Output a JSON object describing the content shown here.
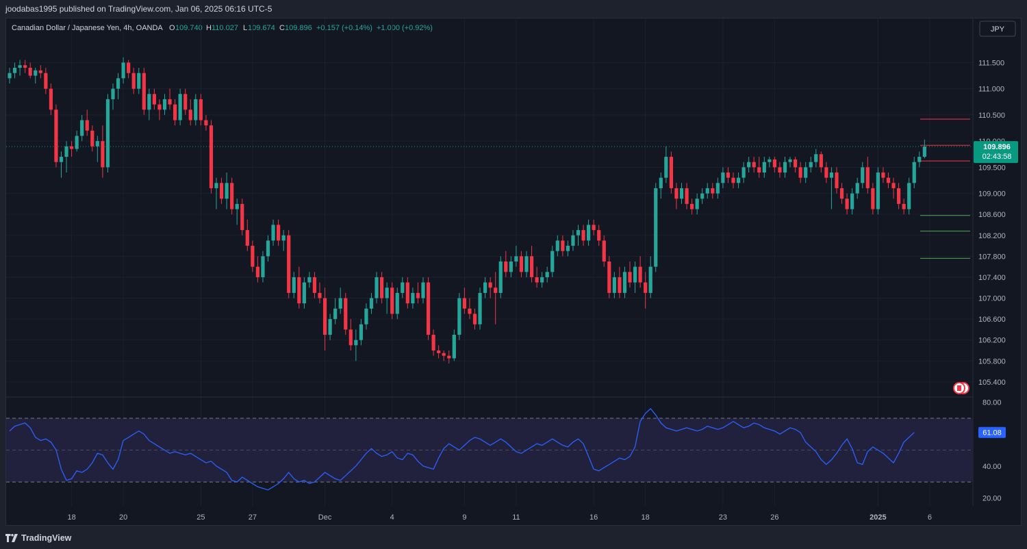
{
  "header": {
    "publisher_line": "joodabas1995 published on TradingView.com, Jan 06, 2025 06:16 UTC-5"
  },
  "symbol": {
    "title": "Canadian Dollar / Japanese Yen, 4h, OANDA",
    "open_label": "O",
    "open": "109.740",
    "high_label": "H",
    "high": "110.027",
    "low_label": "L",
    "low": "109.674",
    "close_label": "C",
    "close": "109.896",
    "change": "+0.157 (+0.14%)",
    "extra_change": "+1.000 (+0.92%)",
    "currency_button": "JPY"
  },
  "price_tag": {
    "price": "109.896",
    "countdown": "02:43:58"
  },
  "rsi_tag": "61.08",
  "colors": {
    "up": "#26a69a",
    "down": "#f23645",
    "rsi_line": "#2962ff",
    "band_fill": "#21213d",
    "last_price_line": "#089981",
    "h_resistance": "#f23645",
    "h_support": "#4caf50"
  },
  "chart_data": {
    "type": "candlestick",
    "timeframe": "4h",
    "price_axis": {
      "ylim": [
        105.15,
        111.95
      ],
      "ticks": [
        "111.500",
        "111.000",
        "110.500",
        "110.000",
        "109.500",
        "109.000",
        "108.600",
        "108.200",
        "107.800",
        "107.400",
        "107.000",
        "106.600",
        "106.200",
        "105.800",
        "105.400"
      ],
      "tick_values": [
        111.5,
        111.0,
        110.5,
        110.0,
        109.5,
        109.0,
        108.6,
        108.2,
        107.8,
        107.4,
        107.0,
        106.6,
        106.2,
        105.8,
        105.4
      ]
    },
    "x_axis": {
      "labels": [
        "18",
        "20",
        "25",
        "27",
        "Dec",
        "4",
        "9",
        "11",
        "16",
        "18",
        "23",
        "26",
        "2025",
        "6"
      ],
      "label_index": [
        12,
        22,
        37,
        47,
        61,
        74,
        88,
        98,
        113,
        123,
        138,
        148,
        168,
        178
      ]
    },
    "candles_ohlc": [
      [
        111.2,
        111.4,
        111.1,
        111.3
      ],
      [
        111.3,
        111.5,
        111.2,
        111.4
      ],
      [
        111.4,
        111.55,
        111.25,
        111.45
      ],
      [
        111.45,
        111.55,
        111.3,
        111.4
      ],
      [
        111.4,
        111.5,
        111.2,
        111.25
      ],
      [
        111.25,
        111.4,
        111.1,
        111.35
      ],
      [
        111.35,
        111.45,
        111.2,
        111.3
      ],
      [
        111.3,
        111.4,
        110.9,
        111.0
      ],
      [
        111.0,
        111.1,
        110.5,
        110.6
      ],
      [
        110.6,
        110.7,
        109.5,
        109.6
      ],
      [
        109.6,
        109.8,
        109.3,
        109.7
      ],
      [
        109.7,
        110.0,
        109.4,
        109.9
      ],
      [
        109.9,
        110.0,
        109.7,
        109.85
      ],
      [
        109.85,
        110.2,
        109.8,
        110.1
      ],
      [
        110.1,
        110.5,
        110.0,
        110.4
      ],
      [
        110.4,
        110.6,
        110.1,
        110.2
      ],
      [
        110.2,
        110.3,
        109.8,
        109.9
      ],
      [
        109.9,
        110.1,
        109.6,
        110.0
      ],
      [
        110.0,
        110.3,
        109.3,
        109.5
      ],
      [
        109.5,
        110.9,
        109.4,
        110.8
      ],
      [
        110.8,
        111.1,
        110.6,
        111.0
      ],
      [
        111.0,
        111.3,
        110.8,
        111.2
      ],
      [
        111.2,
        111.6,
        111.1,
        111.5
      ],
      [
        111.5,
        111.55,
        111.2,
        111.3
      ],
      [
        111.3,
        111.4,
        110.9,
        111.0
      ],
      [
        111.0,
        111.4,
        110.9,
        111.3
      ],
      [
        111.3,
        111.4,
        110.5,
        110.6
      ],
      [
        110.6,
        111.0,
        110.4,
        110.9
      ],
      [
        110.9,
        111.0,
        110.6,
        110.7
      ],
      [
        110.7,
        110.8,
        110.4,
        110.6
      ],
      [
        110.6,
        110.9,
        110.5,
        110.8
      ],
      [
        110.8,
        111.0,
        110.6,
        110.7
      ],
      [
        110.7,
        110.8,
        110.3,
        110.4
      ],
      [
        110.4,
        111.0,
        110.3,
        110.9
      ],
      [
        110.9,
        111.0,
        110.5,
        110.6
      ],
      [
        110.6,
        110.8,
        110.3,
        110.4
      ],
      [
        110.4,
        110.9,
        110.3,
        110.8
      ],
      [
        110.8,
        110.9,
        110.3,
        110.4
      ],
      [
        110.4,
        110.5,
        110.2,
        110.3
      ],
      [
        110.3,
        110.4,
        109.0,
        109.1
      ],
      [
        109.1,
        109.3,
        108.7,
        109.2
      ],
      [
        109.2,
        109.3,
        108.8,
        108.9
      ],
      [
        108.9,
        109.4,
        108.7,
        109.2
      ],
      [
        109.2,
        109.3,
        108.6,
        108.7
      ],
      [
        108.7,
        108.9,
        108.4,
        108.8
      ],
      [
        108.8,
        108.9,
        108.2,
        108.3
      ],
      [
        108.3,
        108.5,
        107.9,
        108.0
      ],
      [
        108.0,
        108.1,
        107.5,
        107.6
      ],
      [
        107.6,
        107.8,
        107.3,
        107.4
      ],
      [
        107.4,
        107.9,
        107.3,
        107.8
      ],
      [
        107.8,
        108.2,
        107.7,
        108.1
      ],
      [
        108.1,
        108.5,
        108.0,
        108.4
      ],
      [
        108.4,
        108.5,
        108.0,
        108.1
      ],
      [
        108.1,
        108.3,
        107.9,
        108.2
      ],
      [
        108.2,
        108.3,
        107.0,
        107.1
      ],
      [
        107.1,
        107.5,
        107.0,
        107.4
      ],
      [
        107.4,
        107.6,
        106.8,
        106.9
      ],
      [
        106.9,
        107.4,
        106.8,
        107.3
      ],
      [
        107.3,
        107.5,
        107.2,
        107.4
      ],
      [
        107.4,
        107.5,
        107.0,
        107.1
      ],
      [
        107.1,
        107.3,
        106.9,
        107.0
      ],
      [
        107.0,
        107.2,
        106.0,
        106.3
      ],
      [
        106.3,
        106.7,
        106.2,
        106.6
      ],
      [
        106.6,
        107.0,
        106.5,
        106.8
      ],
      [
        106.8,
        107.2,
        106.7,
        107.0
      ],
      [
        107.0,
        107.1,
        106.3,
        106.4
      ],
      [
        106.4,
        106.6,
        106.0,
        106.1
      ],
      [
        106.1,
        106.4,
        105.8,
        106.2
      ],
      [
        106.2,
        106.6,
        106.1,
        106.5
      ],
      [
        106.5,
        106.9,
        106.4,
        106.8
      ],
      [
        106.8,
        107.1,
        106.7,
        107.0
      ],
      [
        107.0,
        107.5,
        106.9,
        107.4
      ],
      [
        107.4,
        107.5,
        106.9,
        107.0
      ],
      [
        107.0,
        107.3,
        106.7,
        107.2
      ],
      [
        107.2,
        107.3,
        106.6,
        106.7
      ],
      [
        106.7,
        107.2,
        106.6,
        107.1
      ],
      [
        107.1,
        107.4,
        107.0,
        107.3
      ],
      [
        107.3,
        107.4,
        106.8,
        106.9
      ],
      [
        106.9,
        107.2,
        106.8,
        107.1
      ],
      [
        107.1,
        107.3,
        106.9,
        107.0
      ],
      [
        107.0,
        107.4,
        106.9,
        107.3
      ],
      [
        107.3,
        107.4,
        106.2,
        106.3
      ],
      [
        106.3,
        106.4,
        105.9,
        106.0
      ],
      [
        106.0,
        106.1,
        105.85,
        105.95
      ],
      [
        105.95,
        106.0,
        105.8,
        105.9
      ],
      [
        105.9,
        106.0,
        105.75,
        105.85
      ],
      [
        105.85,
        106.4,
        105.8,
        106.3
      ],
      [
        106.3,
        107.1,
        106.2,
        107.0
      ],
      [
        107.0,
        107.2,
        106.7,
        106.8
      ],
      [
        106.8,
        107.0,
        106.6,
        106.7
      ],
      [
        106.7,
        106.8,
        106.4,
        106.5
      ],
      [
        106.5,
        107.2,
        106.4,
        107.1
      ],
      [
        107.1,
        107.4,
        107.0,
        107.3
      ],
      [
        107.3,
        107.4,
        107.0,
        107.2
      ],
      [
        107.2,
        107.5,
        106.5,
        107.1
      ],
      [
        107.1,
        107.8,
        107.0,
        107.7
      ],
      [
        107.7,
        107.9,
        107.4,
        107.5
      ],
      [
        107.5,
        107.8,
        107.4,
        107.7
      ],
      [
        107.7,
        108.0,
        107.6,
        107.8
      ],
      [
        107.8,
        107.9,
        107.4,
        107.5
      ],
      [
        107.5,
        107.9,
        107.4,
        107.8
      ],
      [
        107.8,
        108.0,
        107.3,
        107.4
      ],
      [
        107.4,
        107.6,
        107.2,
        107.3
      ],
      [
        107.3,
        107.5,
        107.2,
        107.4
      ],
      [
        107.4,
        107.6,
        107.3,
        107.5
      ],
      [
        107.5,
        108.0,
        107.4,
        107.9
      ],
      [
        107.9,
        108.2,
        107.8,
        108.1
      ],
      [
        108.1,
        108.2,
        107.8,
        107.9
      ],
      [
        107.9,
        108.1,
        107.8,
        108.0
      ],
      [
        108.0,
        108.3,
        107.9,
        108.2
      ],
      [
        108.2,
        108.4,
        108.0,
        108.3
      ],
      [
        108.3,
        108.4,
        108.0,
        108.1
      ],
      [
        108.1,
        108.5,
        108.0,
        108.4
      ],
      [
        108.4,
        108.5,
        108.2,
        108.3
      ],
      [
        108.3,
        108.4,
        108.0,
        108.1
      ],
      [
        108.1,
        108.2,
        107.6,
        107.7
      ],
      [
        107.7,
        107.8,
        107.0,
        107.1
      ],
      [
        107.1,
        107.5,
        107.0,
        107.4
      ],
      [
        107.4,
        107.6,
        107.0,
        107.1
      ],
      [
        107.1,
        107.6,
        107.0,
        107.5
      ],
      [
        107.5,
        107.7,
        107.2,
        107.3
      ],
      [
        107.3,
        107.7,
        107.1,
        107.6
      ],
      [
        107.6,
        107.8,
        107.2,
        107.3
      ],
      [
        107.3,
        107.5,
        106.8,
        107.1
      ],
      [
        107.1,
        107.8,
        107.0,
        107.6
      ],
      [
        107.6,
        109.2,
        107.5,
        109.1
      ],
      [
        109.1,
        109.4,
        108.9,
        109.3
      ],
      [
        109.3,
        109.9,
        109.2,
        109.7
      ],
      [
        109.7,
        109.8,
        109.0,
        109.1
      ],
      [
        109.1,
        109.2,
        108.7,
        108.9
      ],
      [
        108.9,
        109.2,
        108.8,
        109.1
      ],
      [
        109.1,
        109.2,
        108.7,
        108.8
      ],
      [
        108.8,
        108.9,
        108.6,
        108.7
      ],
      [
        108.7,
        109.0,
        108.6,
        108.9
      ],
      [
        108.9,
        109.1,
        108.8,
        109.0
      ],
      [
        109.0,
        109.2,
        108.9,
        109.1
      ],
      [
        109.1,
        109.2,
        108.9,
        109.0
      ],
      [
        109.0,
        109.3,
        108.9,
        109.2
      ],
      [
        109.2,
        109.5,
        109.1,
        109.4
      ],
      [
        109.4,
        109.5,
        109.2,
        109.3
      ],
      [
        109.3,
        109.4,
        109.1,
        109.2
      ],
      [
        109.2,
        109.4,
        109.1,
        109.3
      ],
      [
        109.3,
        109.6,
        109.2,
        109.5
      ],
      [
        109.5,
        109.7,
        109.4,
        109.6
      ],
      [
        109.6,
        109.7,
        109.4,
        109.5
      ],
      [
        109.5,
        109.7,
        109.3,
        109.4
      ],
      [
        109.4,
        109.7,
        109.3,
        109.6
      ],
      [
        109.6,
        109.7,
        109.5,
        109.65
      ],
      [
        109.65,
        109.7,
        109.4,
        109.5
      ],
      [
        109.5,
        109.6,
        109.3,
        109.4
      ],
      [
        109.4,
        109.7,
        109.3,
        109.6
      ],
      [
        109.6,
        109.7,
        109.5,
        109.65
      ],
      [
        109.65,
        109.7,
        109.4,
        109.5
      ],
      [
        109.5,
        109.6,
        109.2,
        109.3
      ],
      [
        109.3,
        109.6,
        109.2,
        109.5
      ],
      [
        109.5,
        109.7,
        109.4,
        109.6
      ],
      [
        109.6,
        109.85,
        109.5,
        109.75
      ],
      [
        109.75,
        109.8,
        109.4,
        109.5
      ],
      [
        109.5,
        109.6,
        109.2,
        109.3
      ],
      [
        109.3,
        109.5,
        108.7,
        109.4
      ],
      [
        109.4,
        109.5,
        109.0,
        109.1
      ],
      [
        109.1,
        109.2,
        108.8,
        108.9
      ],
      [
        108.9,
        109.0,
        108.6,
        108.7
      ],
      [
        108.7,
        109.1,
        108.6,
        109.0
      ],
      [
        109.0,
        109.3,
        108.9,
        109.2
      ],
      [
        109.2,
        109.6,
        109.1,
        109.5
      ],
      [
        109.5,
        109.7,
        109.0,
        109.1
      ],
      [
        109.1,
        109.2,
        108.6,
        108.7
      ],
      [
        108.7,
        109.5,
        108.6,
        109.4
      ],
      [
        109.4,
        109.5,
        109.2,
        109.3
      ],
      [
        109.3,
        109.4,
        109.1,
        109.2
      ],
      [
        109.2,
        109.3,
        108.9,
        109.1
      ],
      [
        109.1,
        109.2,
        108.7,
        108.8
      ],
      [
        108.8,
        108.9,
        108.6,
        108.7
      ],
      [
        108.7,
        109.3,
        108.6,
        109.2
      ],
      [
        109.2,
        109.7,
        109.1,
        109.6
      ],
      [
        109.6,
        109.8,
        109.5,
        109.7
      ],
      [
        109.7,
        110.03,
        109.67,
        109.896
      ]
    ],
    "horizontal_lines": [
      {
        "price": 110.42,
        "color": "red"
      },
      {
        "price": 109.92,
        "color": "red"
      },
      {
        "price": 109.62,
        "color": "red"
      },
      {
        "price": 108.58,
        "color": "green"
      },
      {
        "price": 108.28,
        "color": "green"
      },
      {
        "price": 107.76,
        "color": "green"
      }
    ],
    "last_price": 109.896,
    "rsi": {
      "ylim": [
        15,
        82
      ],
      "ticks": [
        "80.00",
        "40.00",
        "20.00"
      ],
      "tick_values": [
        80,
        40,
        20
      ],
      "bands": [
        70,
        30
      ],
      "mid": 50,
      "values": [
        62,
        65,
        66,
        67,
        64,
        58,
        56,
        57,
        55,
        50,
        38,
        31,
        32,
        37,
        36,
        38,
        42,
        48,
        47,
        42,
        38,
        44,
        56,
        58,
        60,
        62,
        60,
        56,
        54,
        52,
        50,
        48,
        49,
        48,
        47,
        48,
        46,
        44,
        42,
        43,
        40,
        38,
        36,
        31,
        30,
        33,
        31,
        29,
        27,
        26,
        25,
        27,
        29,
        32,
        36,
        32,
        30,
        31,
        29,
        30,
        33,
        36,
        34,
        32,
        31,
        34,
        37,
        40,
        44,
        48,
        51,
        48,
        46,
        47,
        49,
        45,
        44,
        48,
        47,
        43,
        40,
        39,
        38,
        45,
        51,
        54,
        52,
        50,
        53,
        56,
        58,
        57,
        55,
        53,
        55,
        57,
        55,
        52,
        49,
        48,
        50,
        52,
        54,
        53,
        55,
        57,
        55,
        53,
        52,
        55,
        57,
        54,
        46,
        38,
        37,
        39,
        41,
        43,
        45,
        44,
        46,
        52,
        68,
        73,
        76,
        72,
        67,
        64,
        63,
        62,
        63,
        64,
        63,
        62,
        63,
        65,
        64,
        63,
        64,
        66,
        68,
        66,
        64,
        65,
        67,
        66,
        64,
        63,
        62,
        60,
        62,
        64,
        63,
        61,
        55,
        52,
        49,
        44,
        41,
        44,
        48,
        53,
        57,
        51,
        42,
        41,
        49,
        52,
        50,
        48,
        45,
        42,
        48,
        55,
        58,
        61.08
      ]
    }
  },
  "brand": {
    "name": "TradingView"
  }
}
